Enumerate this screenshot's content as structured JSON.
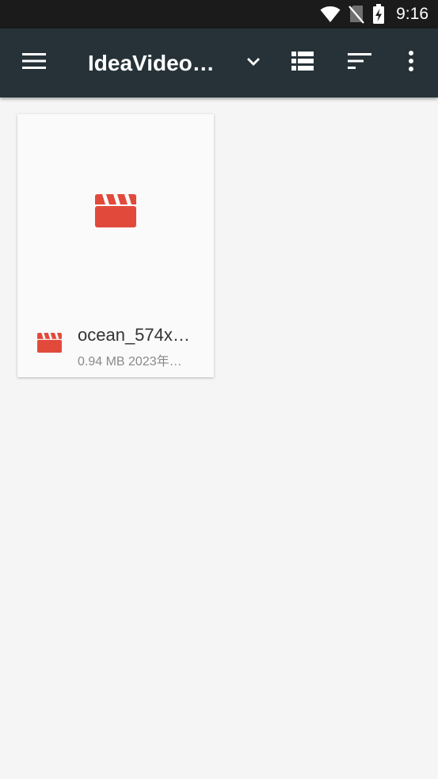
{
  "status_bar": {
    "time": "9:16",
    "icons": [
      "wifi-icon",
      "no-sim-icon",
      "battery-charging-icon"
    ]
  },
  "toolbar": {
    "title": "IdeaVideo…",
    "icons": [
      "menu-icon",
      "chevron-down-icon",
      "list-view-icon",
      "sort-icon",
      "more-vert-icon"
    ]
  },
  "files": [
    {
      "name": "ocean_574x…",
      "size": "0.94 MB",
      "date": "2023年…",
      "meta": "0.94 MB  2023年…",
      "icon": "video-file-icon"
    }
  ],
  "colors": {
    "status_bar_bg": "#1b1b1b",
    "toolbar_bg": "#263238",
    "page_bg": "#f5f5f5",
    "video_icon": "#e14a3b"
  }
}
